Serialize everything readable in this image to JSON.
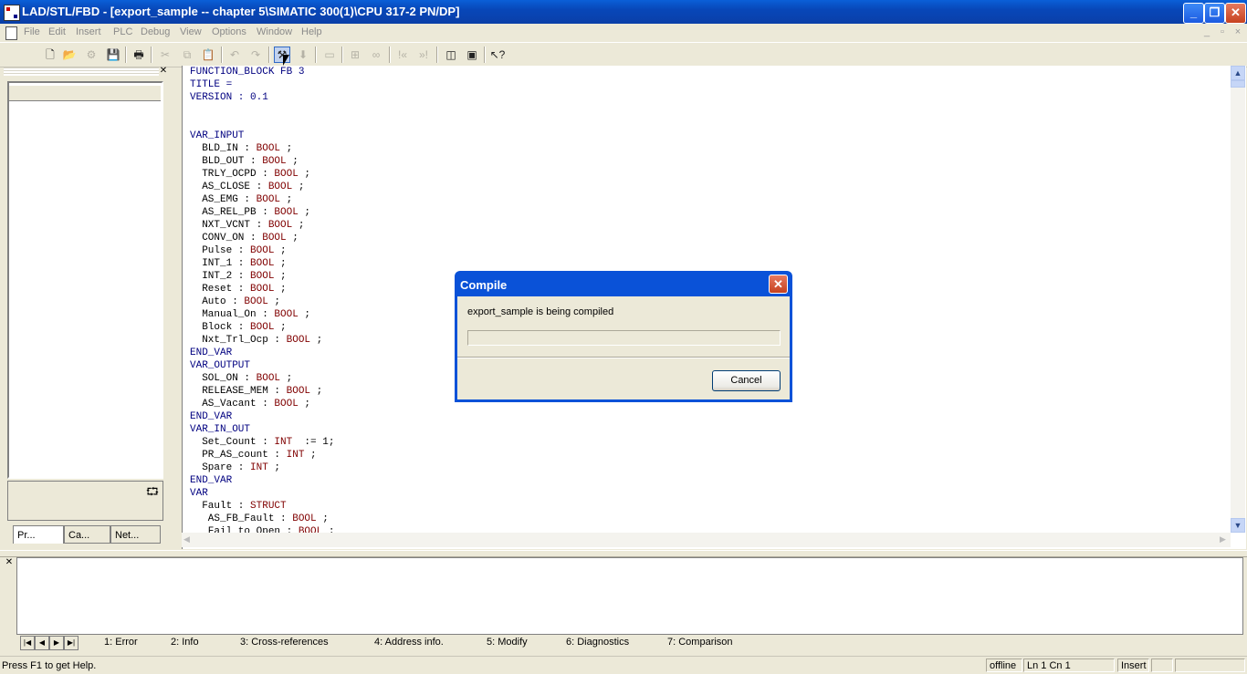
{
  "window": {
    "title": "LAD/STL/FBD  - [export_sample -- chapter 5\\SIMATIC 300(1)\\CPU 317-2 PN/DP]",
    "min_glyph": "_",
    "max_glyph": "❐",
    "close_glyph": "✕"
  },
  "menu": [
    "File",
    "Edit",
    "Insert",
    "PLC",
    "Debug",
    "View",
    "Options",
    "Window",
    "Help"
  ],
  "left_panel": {
    "tabs": [
      "Pr...",
      "Ca...",
      "Net..."
    ]
  },
  "editor": {
    "lines": [
      [
        {
          "t": "FUNCTION_BLOCK FB 3",
          "c": "kw"
        }
      ],
      [
        {
          "t": "TITLE =",
          "c": "kw"
        }
      ],
      [
        {
          "t": "VERSION : 0.1",
          "c": "kw"
        }
      ],
      [
        {
          "t": "",
          "c": ""
        }
      ],
      [
        {
          "t": "",
          "c": ""
        }
      ],
      [
        {
          "t": "VAR_INPUT",
          "c": "kw"
        }
      ],
      [
        {
          "t": "  BLD_IN : ",
          "c": ""
        },
        {
          "t": "BOOL",
          "c": "ty"
        },
        {
          "t": " ;",
          "c": ""
        }
      ],
      [
        {
          "t": "  BLD_OUT : ",
          "c": ""
        },
        {
          "t": "BOOL",
          "c": "ty"
        },
        {
          "t": " ;",
          "c": ""
        }
      ],
      [
        {
          "t": "  TRLY_OCPD : ",
          "c": ""
        },
        {
          "t": "BOOL",
          "c": "ty"
        },
        {
          "t": " ;",
          "c": ""
        }
      ],
      [
        {
          "t": "  AS_CLOSE : ",
          "c": ""
        },
        {
          "t": "BOOL",
          "c": "ty"
        },
        {
          "t": " ;",
          "c": ""
        }
      ],
      [
        {
          "t": "  AS_EMG : ",
          "c": ""
        },
        {
          "t": "BOOL",
          "c": "ty"
        },
        {
          "t": " ;",
          "c": ""
        }
      ],
      [
        {
          "t": "  AS_REL_PB : ",
          "c": ""
        },
        {
          "t": "BOOL",
          "c": "ty"
        },
        {
          "t": " ;",
          "c": ""
        }
      ],
      [
        {
          "t": "  NXT_VCNT : ",
          "c": ""
        },
        {
          "t": "BOOL",
          "c": "ty"
        },
        {
          "t": " ;",
          "c": ""
        }
      ],
      [
        {
          "t": "  CONV_ON : ",
          "c": ""
        },
        {
          "t": "BOOL",
          "c": "ty"
        },
        {
          "t": " ;",
          "c": ""
        }
      ],
      [
        {
          "t": "  Pulse : ",
          "c": ""
        },
        {
          "t": "BOOL",
          "c": "ty"
        },
        {
          "t": " ;",
          "c": ""
        }
      ],
      [
        {
          "t": "  INT_1 : ",
          "c": ""
        },
        {
          "t": "BOOL",
          "c": "ty"
        },
        {
          "t": " ;",
          "c": ""
        }
      ],
      [
        {
          "t": "  INT_2 : ",
          "c": ""
        },
        {
          "t": "BOOL",
          "c": "ty"
        },
        {
          "t": " ;",
          "c": ""
        }
      ],
      [
        {
          "t": "  Reset : ",
          "c": ""
        },
        {
          "t": "BOOL",
          "c": "ty"
        },
        {
          "t": " ;",
          "c": ""
        }
      ],
      [
        {
          "t": "  Auto : ",
          "c": ""
        },
        {
          "t": "BOOL",
          "c": "ty"
        },
        {
          "t": " ;",
          "c": ""
        }
      ],
      [
        {
          "t": "  Manual_On : ",
          "c": ""
        },
        {
          "t": "BOOL",
          "c": "ty"
        },
        {
          "t": " ;",
          "c": ""
        }
      ],
      [
        {
          "t": "  Block : ",
          "c": ""
        },
        {
          "t": "BOOL",
          "c": "ty"
        },
        {
          "t": " ;",
          "c": ""
        }
      ],
      [
        {
          "t": "  Nxt_Trl_Ocp : ",
          "c": ""
        },
        {
          "t": "BOOL",
          "c": "ty"
        },
        {
          "t": " ;",
          "c": ""
        }
      ],
      [
        {
          "t": "END_VAR",
          "c": "kw"
        }
      ],
      [
        {
          "t": "VAR_OUTPUT",
          "c": "kw"
        }
      ],
      [
        {
          "t": "  SOL_ON : ",
          "c": ""
        },
        {
          "t": "BOOL",
          "c": "ty"
        },
        {
          "t": " ;",
          "c": ""
        }
      ],
      [
        {
          "t": "  RELEASE_MEM : ",
          "c": ""
        },
        {
          "t": "BOOL",
          "c": "ty"
        },
        {
          "t": " ;",
          "c": ""
        }
      ],
      [
        {
          "t": "  AS_Vacant : ",
          "c": ""
        },
        {
          "t": "BOOL",
          "c": "ty"
        },
        {
          "t": " ;",
          "c": ""
        }
      ],
      [
        {
          "t": "END_VAR",
          "c": "kw"
        }
      ],
      [
        {
          "t": "VAR_IN_OUT",
          "c": "kw"
        }
      ],
      [
        {
          "t": "  Set_Count : ",
          "c": ""
        },
        {
          "t": "INT",
          "c": "ty"
        },
        {
          "t": "  := 1;",
          "c": ""
        }
      ],
      [
        {
          "t": "  PR_AS_count : ",
          "c": ""
        },
        {
          "t": "INT",
          "c": "ty"
        },
        {
          "t": " ;",
          "c": ""
        }
      ],
      [
        {
          "t": "  Spare : ",
          "c": ""
        },
        {
          "t": "INT",
          "c": "ty"
        },
        {
          "t": " ;",
          "c": ""
        }
      ],
      [
        {
          "t": "END_VAR",
          "c": "kw"
        }
      ],
      [
        {
          "t": "VAR",
          "c": "kw"
        }
      ],
      [
        {
          "t": "  Fault : ",
          "c": ""
        },
        {
          "t": "STRUCT",
          "c": "ty"
        }
      ],
      [
        {
          "t": "   AS_FB_Fault : ",
          "c": ""
        },
        {
          "t": "BOOL",
          "c": "ty"
        },
        {
          "t": " ;",
          "c": ""
        }
      ],
      [
        {
          "t": "   Fail_to_Open : ",
          "c": ""
        },
        {
          "t": "BOOL",
          "c": "ty"
        },
        {
          "t": " ;",
          "c": ""
        }
      ]
    ]
  },
  "output_tabs": [
    "1: Error",
    "2: Info",
    "3: Cross-references",
    "4: Address info.",
    "5: Modify",
    "6: Diagnostics",
    "7: Comparison"
  ],
  "status": {
    "help": "Press F1 to get Help.",
    "mode": "offline",
    "position": "Ln 1 Cn 1",
    "insert": "Insert"
  },
  "dialog": {
    "title": "Compile",
    "message": "export_sample is being compiled",
    "cancel_label": "Cancel",
    "progress_fraction": 0
  }
}
